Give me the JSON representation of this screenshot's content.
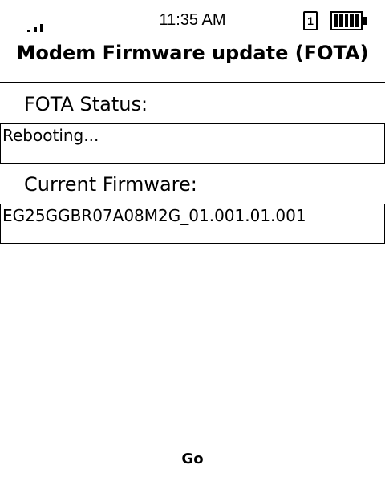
{
  "status_bar": {
    "time": "11:35 AM",
    "sim_slot": "1",
    "signal_icon": "signal-bars-icon",
    "battery_icon": "battery-full-icon"
  },
  "header": {
    "title": "Modem Firmware update (FOTA)"
  },
  "fota_status": {
    "label": "FOTA Status:",
    "value": "Rebooting..."
  },
  "current_firmware": {
    "label": "Current Firmware:",
    "value": "EG25GGBR07A08M2G_01.001.01.001"
  },
  "softkeys": {
    "center": "Go"
  }
}
